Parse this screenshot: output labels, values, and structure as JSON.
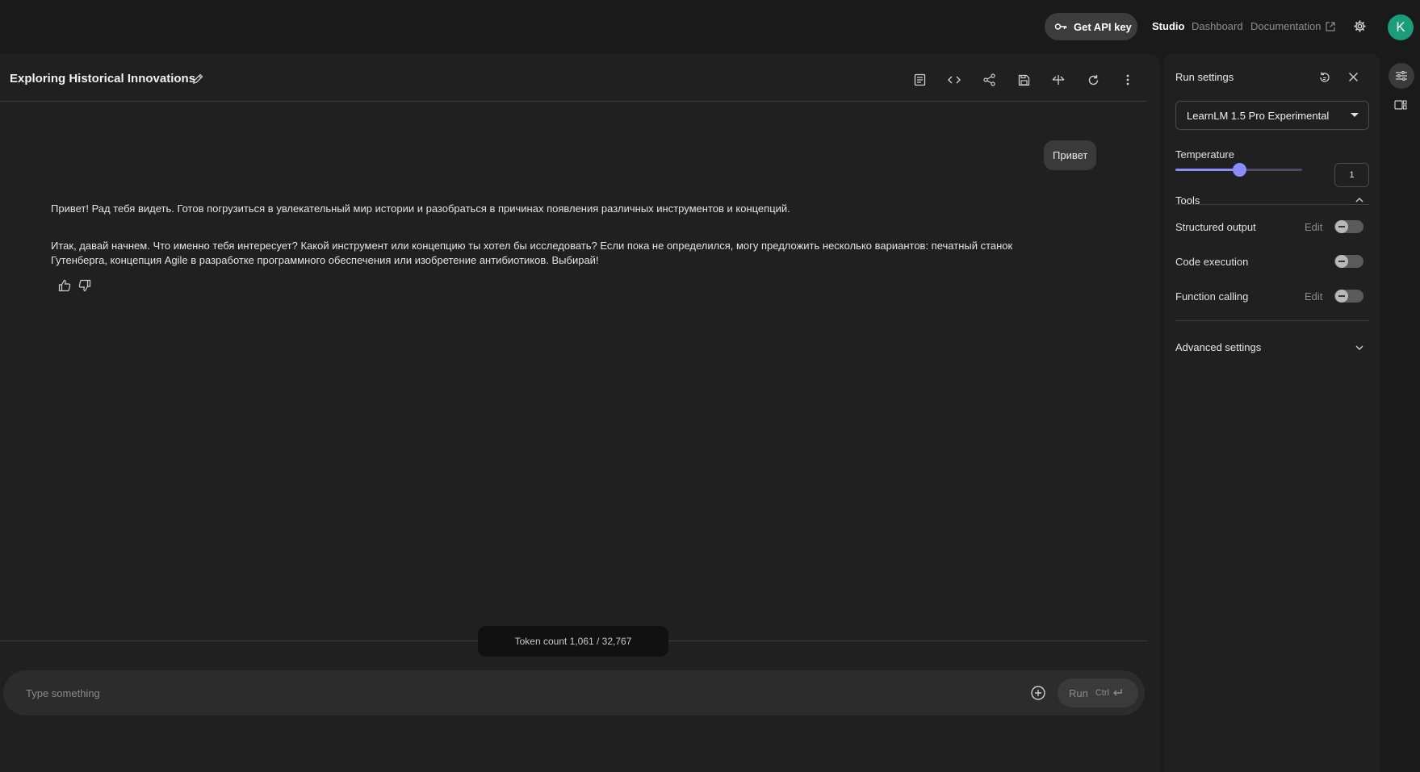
{
  "topbar": {
    "api_key_label": "Get API key",
    "nav": {
      "studio": "Studio",
      "dashboard": "Dashboard",
      "documentation": "Documentation"
    },
    "avatar_letter": "K",
    "avatar_color": "#1a9e7a"
  },
  "chat": {
    "title": "Exploring Historical Innovations",
    "user_message": "Привет",
    "model_paragraphs": [
      "Привет! Рад тебя видеть. Готов погрузиться в увлекательный мир истории и разобраться в причинах появления различных инструментов и концепций.",
      "Итак, давай начнем. Что именно тебя интересует? Какой инструмент или концепцию ты хотел бы исследовать? Если пока не определился, могу предложить несколько вариантов: печатный станок Гутенберга, концепция Agile в разработке программного обеспечения или изобретение антибиотиков. Выбирай!"
    ],
    "token_count": "Token count 1,061 / 32,767",
    "input_placeholder": "Type something",
    "run_label": "Run",
    "run_shortcut": "Ctrl"
  },
  "settings": {
    "title": "Run settings",
    "model": "LearnLM 1.5 Pro Experimental",
    "temperature_label": "Temperature",
    "temperature_value": "1",
    "temperature_fraction": 0.5,
    "tools_label": "Tools",
    "tools": [
      {
        "name": "Structured output",
        "edit": "Edit",
        "enabled": false
      },
      {
        "name": "Code execution",
        "edit": "",
        "enabled": false
      },
      {
        "name": "Function calling",
        "edit": "Edit",
        "enabled": false
      }
    ],
    "advanced_label": "Advanced settings",
    "accent_color": "#8c8cff"
  }
}
